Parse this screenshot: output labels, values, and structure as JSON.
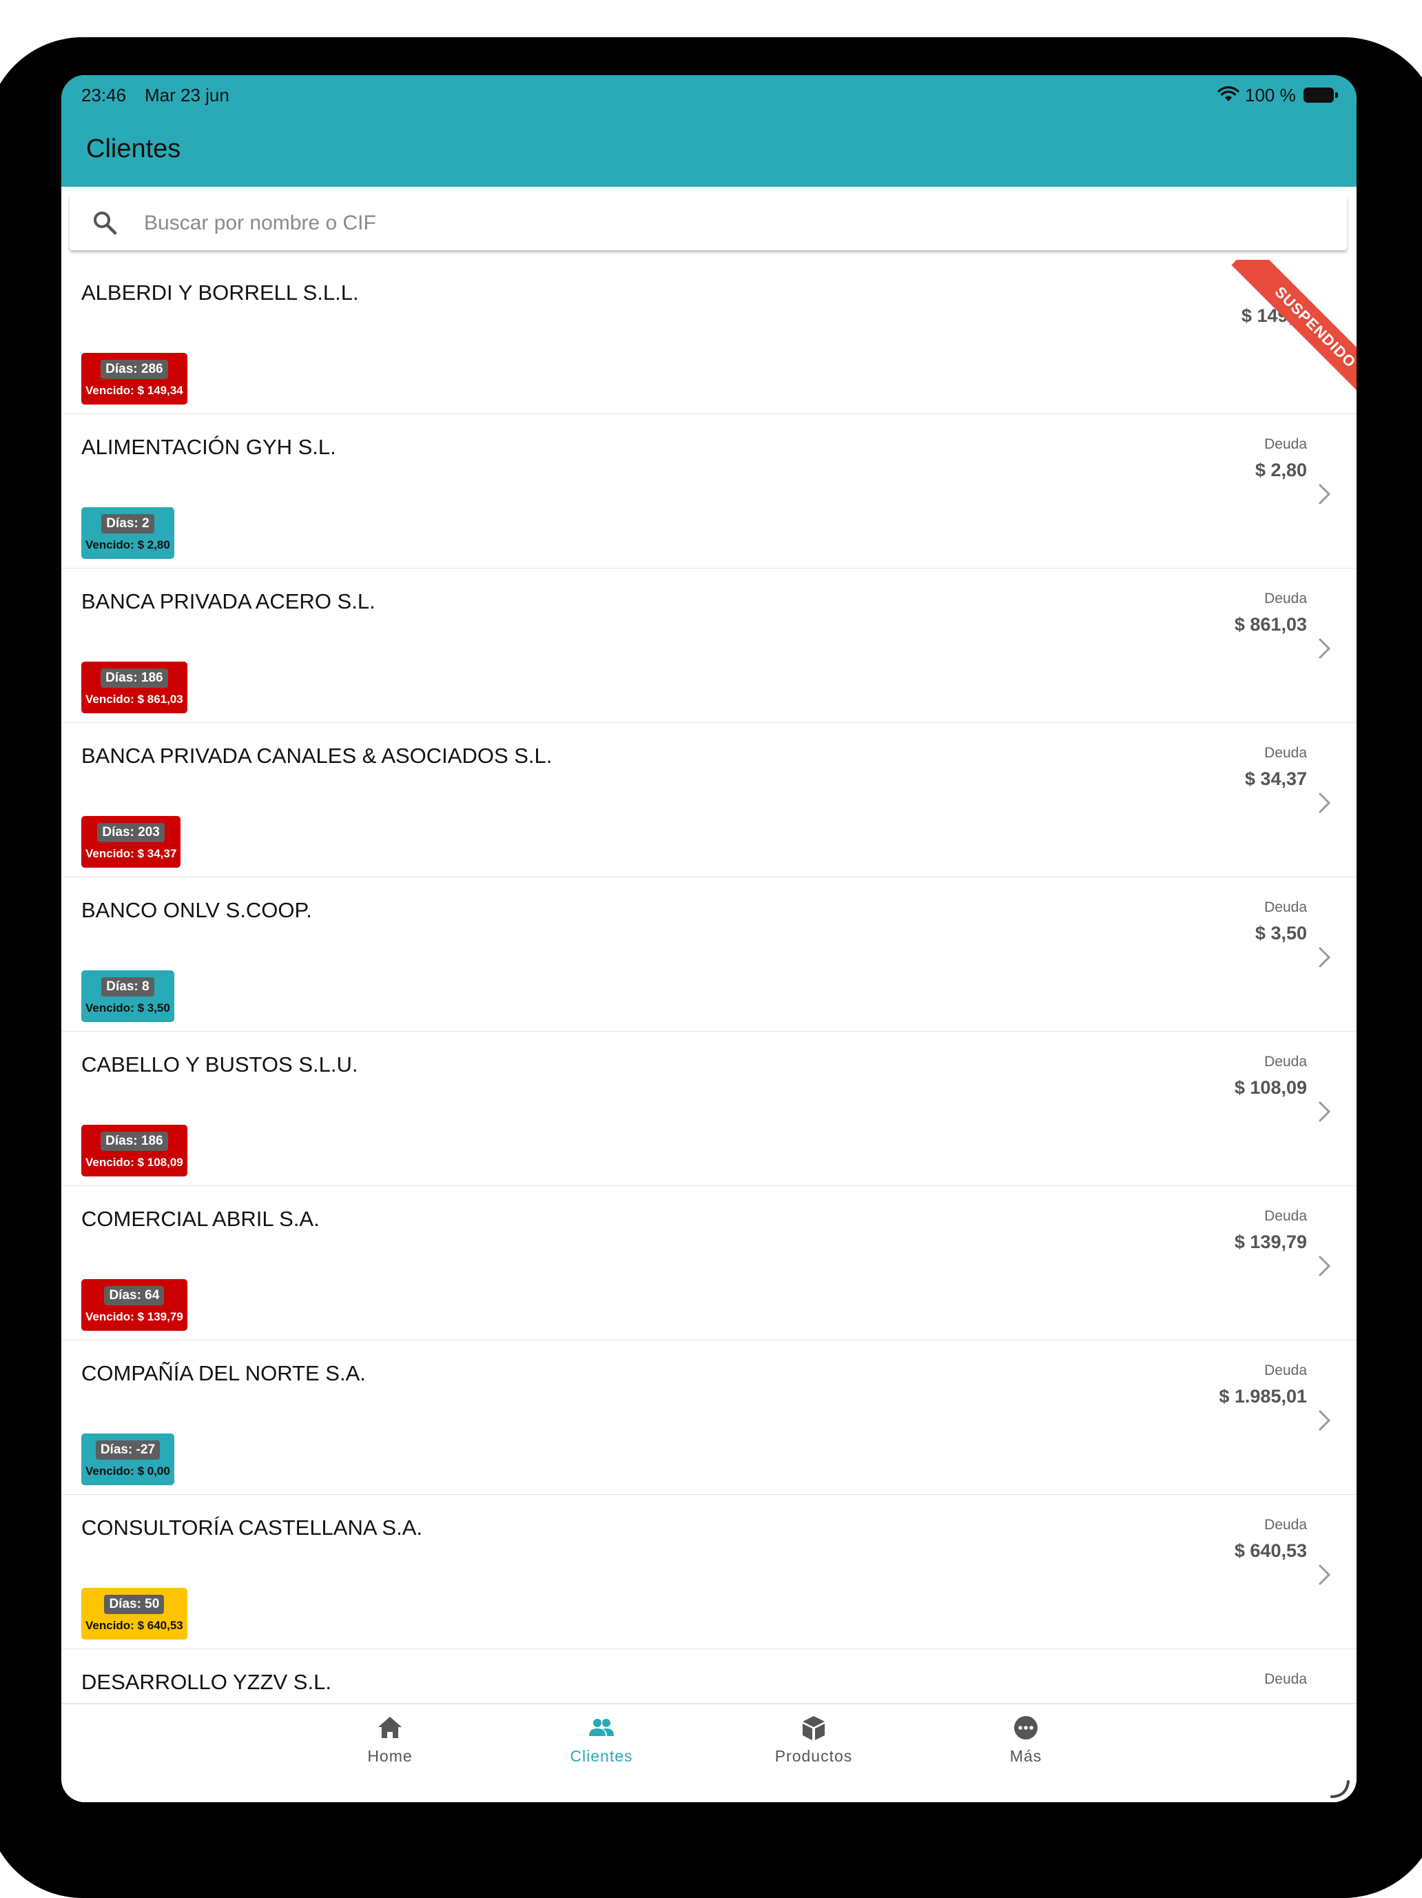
{
  "status_bar": {
    "time": "23:46",
    "date": "Mar 23 jun",
    "battery": "100 %"
  },
  "header": {
    "title": "Clientes",
    "color": "#2aa9b6"
  },
  "search": {
    "placeholder": "Buscar por nombre o CIF",
    "icon": "search-icon"
  },
  "clients": [
    {
      "name": "ALBERDI Y BORRELL S.L.L.",
      "deuda_label": "",
      "deuda": "$ 149,",
      "dias": "Días: 286",
      "vencido": "Vencido: $ 149,34",
      "status": "red",
      "ribbon": "SUSPENDIDO"
    },
    {
      "name": "ALIMENTACIÓN GYH S.L.",
      "deuda_label": "Deuda",
      "deuda": "$ 2,80",
      "dias": "Días: 2",
      "vencido": "Vencido: $ 2,80",
      "status": "teal"
    },
    {
      "name": "BANCA PRIVADA ACERO S.L.",
      "deuda_label": "Deuda",
      "deuda": "$ 861,03",
      "dias": "Días: 186",
      "vencido": "Vencido: $ 861,03",
      "status": "red"
    },
    {
      "name": "BANCA PRIVADA CANALES & ASOCIADOS S.L.",
      "deuda_label": "Deuda",
      "deuda": "$ 34,37",
      "dias": "Días: 203",
      "vencido": "Vencido: $ 34,37",
      "status": "red"
    },
    {
      "name": "BANCO ONLV S.COOP.",
      "deuda_label": "Deuda",
      "deuda": "$ 3,50",
      "dias": "Días: 8",
      "vencido": "Vencido: $ 3,50",
      "status": "teal"
    },
    {
      "name": "CABELLO Y BUSTOS S.L.U.",
      "deuda_label": "Deuda",
      "deuda": "$ 108,09",
      "dias": "Días: 186",
      "vencido": "Vencido: $ 108,09",
      "status": "red"
    },
    {
      "name": "COMERCIAL ABRIL S.A.",
      "deuda_label": "Deuda",
      "deuda": "$ 139,79",
      "dias": "Días: 64",
      "vencido": "Vencido: $ 139,79",
      "status": "red"
    },
    {
      "name": "COMPAÑÍA DEL NORTE S.A.",
      "deuda_label": "Deuda",
      "deuda": "$ 1.985,01",
      "dias": "Días: -27",
      "vencido": "Vencido: $ 0,00",
      "status": "teal"
    },
    {
      "name": "CONSULTORÍA CASTELLANA S.A.",
      "deuda_label": "Deuda",
      "deuda": "$ 640,53",
      "dias": "Días: 50",
      "vencido": "Vencido: $ 640,53",
      "status": "yellow"
    },
    {
      "name": "DESARROLLO YZZV S.L.",
      "deuda_label": "Deuda",
      "deuda": "",
      "dias": "",
      "vencido": "",
      "status": "none"
    }
  ],
  "nav": {
    "items": [
      {
        "label": "Home",
        "icon": "home-icon"
      },
      {
        "label": "Clientes",
        "icon": "users-icon",
        "active": true
      },
      {
        "label": "Productos",
        "icon": "box-icon"
      },
      {
        "label": "Más",
        "icon": "more-icon"
      }
    ]
  },
  "colors": {
    "accent": "#2aa9b6",
    "danger": "#cc0000",
    "warning": "#ffc400",
    "ribbon": "#e74c3c"
  }
}
